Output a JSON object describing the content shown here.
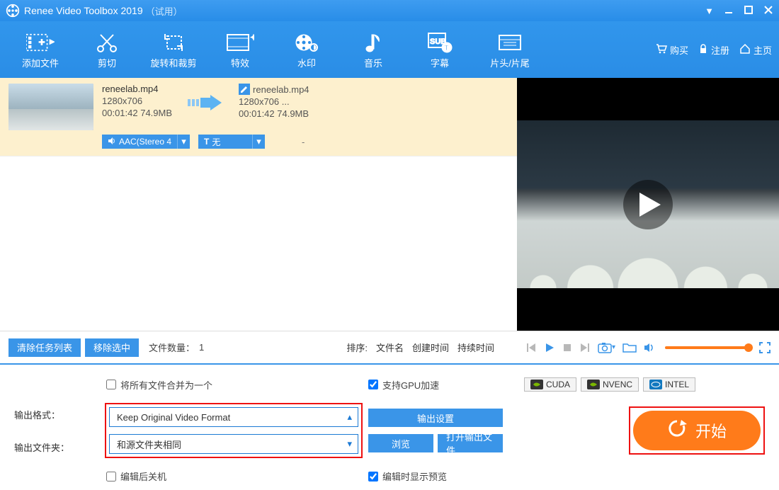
{
  "title": {
    "app": "Renee Video Toolbox 2019",
    "trial": "（试用）"
  },
  "toolbar": {
    "items": [
      {
        "label": "添加文件"
      },
      {
        "label": "剪切"
      },
      {
        "label": "旋转和裁剪"
      },
      {
        "label": "特效"
      },
      {
        "label": "水印"
      },
      {
        "label": "音乐"
      },
      {
        "label": "字幕"
      },
      {
        "label": "片头/片尾"
      }
    ],
    "right": {
      "buy": "购买",
      "register": "注册",
      "home": "主页"
    }
  },
  "file": {
    "in": {
      "name": "reneelab.mp4",
      "res": "1280x706",
      "dur_size": "00:01:42  74.9MB"
    },
    "out": {
      "name": "reneelab.mp4",
      "res": "1280x706    ...",
      "dur_size": "00:01:42  74.9MB"
    },
    "audio_btn": "AAC(Stereo 4",
    "sub_btn_prefix": "T",
    "sub_btn": "无",
    "dash": "-"
  },
  "controls": {
    "clear": "清除任务列表",
    "remove_selected": "移除选中",
    "file_count_label": "文件数量：",
    "file_count_value": "1",
    "sort_label": "排序:",
    "sort_name": "文件名",
    "sort_created": "创建时间",
    "sort_duration": "持续时间"
  },
  "bottom": {
    "merge": "将所有文件合并为一个",
    "gpu": "支持GPU加速",
    "badges": {
      "cuda": "CUDA",
      "nvenc": "NVENC",
      "intel": "INTEL"
    },
    "format_label": "输出格式：",
    "format_value": "Keep Original Video Format",
    "folder_label": "输出文件夹：",
    "folder_value": "和源文件夹相同",
    "output_settings": "输出设置",
    "browse": "浏览",
    "open_output": "打开输出文件",
    "edit_shutdown": "编辑后关机",
    "edit_preview": "编辑时显示预览",
    "start": "开始"
  }
}
